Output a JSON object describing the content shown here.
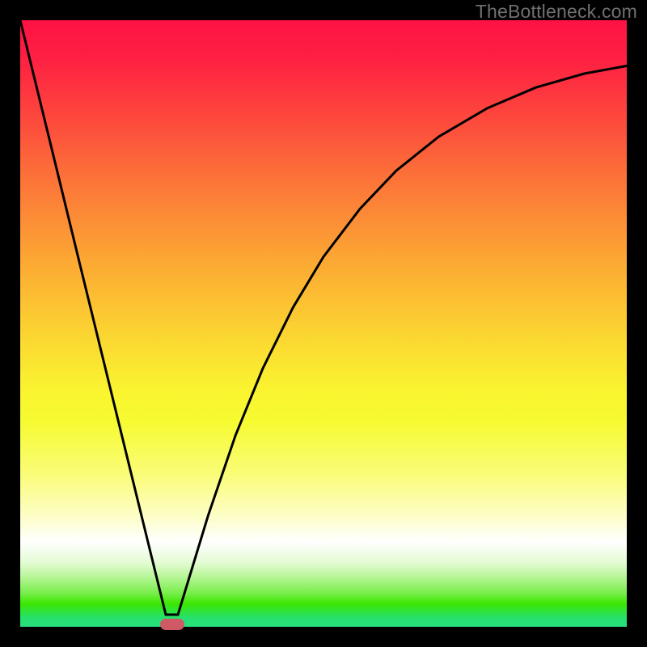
{
  "watermark": "TheBottleneck.com",
  "colors": {
    "page_bg": "#000000",
    "curve_stroke": "#000000",
    "marker_fill": "#cf5965",
    "gradient_top": "#fe1244",
    "gradient_bottom": "#27e07f"
  },
  "chart_data": {
    "type": "line",
    "title": "",
    "xlabel": "",
    "ylabel": "",
    "xlim": [
      0,
      1
    ],
    "ylim": [
      0,
      1
    ],
    "grid": false,
    "legend": false,
    "series": [
      {
        "name": "curve",
        "x": [
          0.0,
          0.05,
          0.1,
          0.15,
          0.2,
          0.24,
          0.26,
          0.31,
          0.355,
          0.4,
          0.45,
          0.5,
          0.56,
          0.62,
          0.69,
          0.77,
          0.85,
          0.93,
          1.018
        ],
        "y": [
          1.0,
          0.796,
          0.591,
          0.387,
          0.183,
          0.02,
          0.02,
          0.184,
          0.316,
          0.426,
          0.527,
          0.61,
          0.689,
          0.752,
          0.808,
          0.855,
          0.889,
          0.912,
          0.928
        ]
      }
    ],
    "marker": {
      "x": 0.25,
      "y": 0.004,
      "shape": "pill"
    },
    "background": "vertical-rainbow-gradient"
  }
}
